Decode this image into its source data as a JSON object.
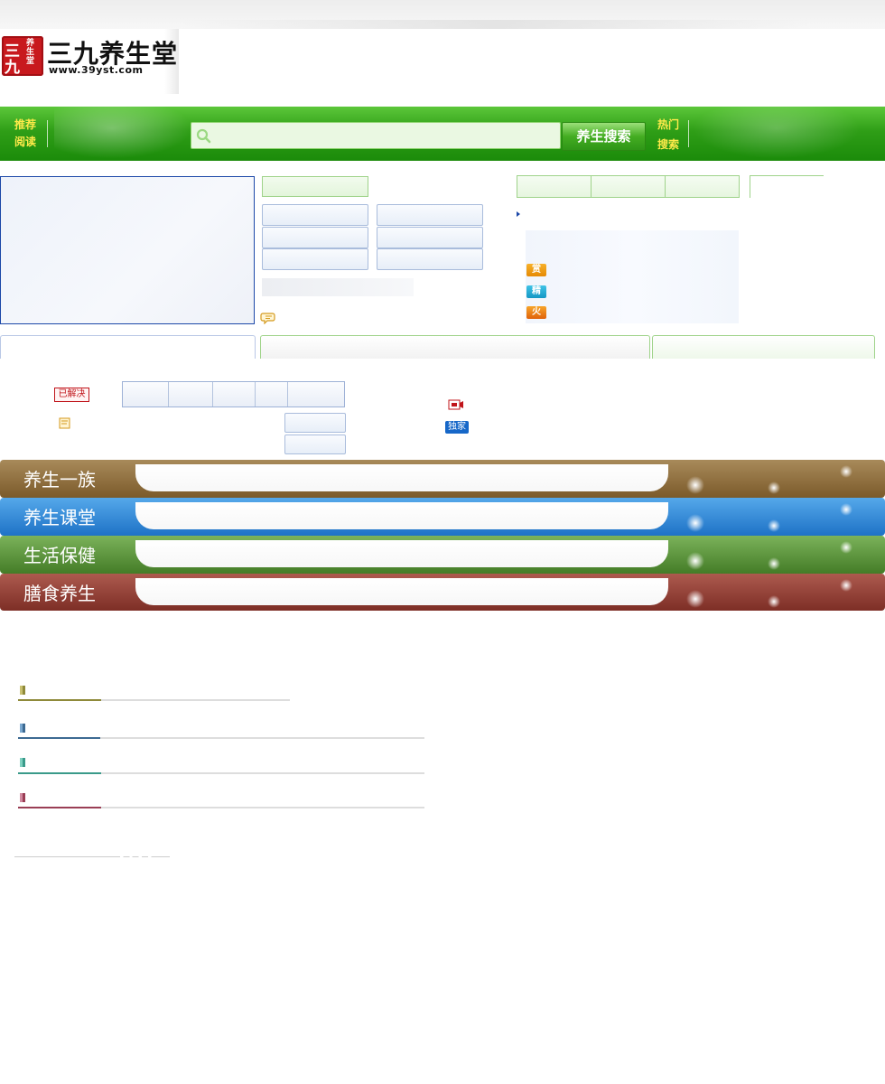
{
  "site": {
    "seal_char_1": "三",
    "seal_char_2": "九",
    "seal_small": "养生堂",
    "name": "三九养生堂",
    "url": "www.39yst.com"
  },
  "nav": {
    "left_links": [
      "推荐",
      "阅读"
    ],
    "search_button": "养生搜索",
    "search_placeholder": "",
    "right_links": [
      "热门",
      "搜索"
    ]
  },
  "badges": {
    "reward": "赏",
    "essence": "精",
    "hot": "火",
    "solved": "已解决",
    "exclusive": "独家"
  },
  "banners": [
    {
      "label": "养生一族",
      "color": "#8a6a35"
    },
    {
      "label": "养生课堂",
      "color": "#2a7fcf"
    },
    {
      "label": "生活保健",
      "color": "#4e8a30"
    },
    {
      "label": "膳食养生",
      "color": "#8c3a30"
    }
  ],
  "colors": {
    "nav_green": "#2f9e17",
    "nav_link_yellow": "#ffea4a",
    "section_lines": [
      "#8f8a3a",
      "#3d6a92",
      "#3a9a8a",
      "#9a3e55"
    ]
  }
}
